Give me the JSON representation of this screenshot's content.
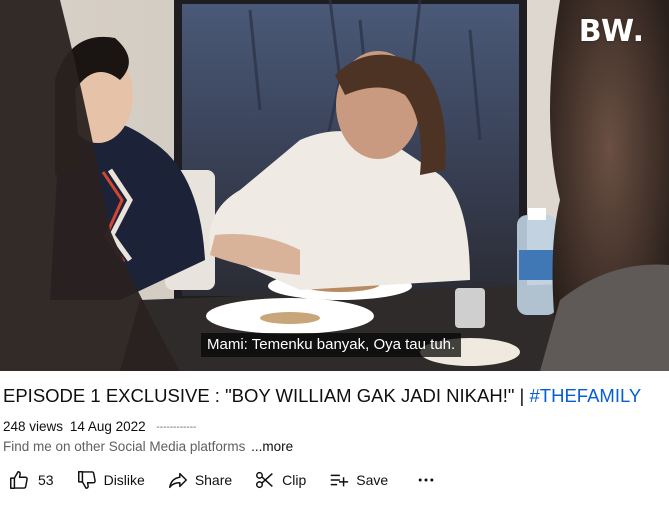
{
  "video": {
    "watermark": "BW.",
    "subtitle": "Mami: Temenku banyak, Oya tau tuh."
  },
  "title": {
    "main": "EPISODE 1 EXCLUSIVE : \"BOY WILLIAM GAK JADI NIKAH!\" | ",
    "hashtag": "#THEFAMILY"
  },
  "meta": {
    "views": "248 views",
    "date": "14 Aug 2022",
    "separator": "------------"
  },
  "description": {
    "text": "Find me on other Social Media platforms",
    "more": "...more"
  },
  "actions": {
    "like_count": "53",
    "dislike": "Dislike",
    "share": "Share",
    "clip": "Clip",
    "save": "Save"
  },
  "icons": {
    "like": "thumbs-up-icon",
    "dislike": "thumbs-down-icon",
    "share": "share-arrow-icon",
    "clip": "scissors-icon",
    "save": "playlist-add-icon",
    "more": "more-horizontal-icon"
  },
  "colors": {
    "hashtag": "#065fd4",
    "text": "#0f0f0f",
    "secondary_text": "#606060"
  }
}
